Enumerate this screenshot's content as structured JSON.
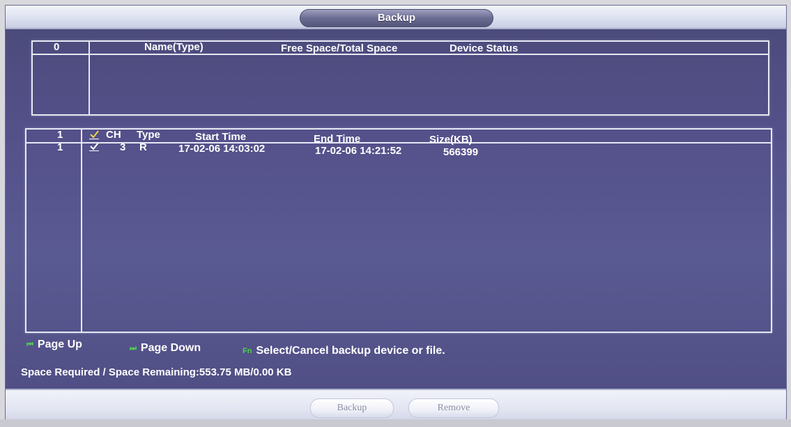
{
  "window": {
    "title": "Backup"
  },
  "device_table": {
    "count": "0",
    "columns": [
      "Name(Type)",
      "Free Space/Total Space",
      "Device Status"
    ]
  },
  "file_table": {
    "count": "1",
    "header_checked": true,
    "columns": [
      "CH",
      "Type",
      "Start Time",
      "End Time",
      "Size(KB)"
    ],
    "rows": [
      {
        "index": "1",
        "checked": true,
        "ch": "3",
        "type": "R",
        "start_time": "17-02-06 14:03:02",
        "end_time": "17-02-06 14:21:52",
        "size": "566399"
      }
    ]
  },
  "legend": {
    "page_up_icon": "page-up-key-icon",
    "page_up": "Page Up",
    "page_down_icon": "page-down-key-icon",
    "page_down": "Page Down",
    "fn_icon": "fn-key-icon",
    "fn_key": "Fn",
    "fn_text": "Select/Cancel backup device or file."
  },
  "status": {
    "space_text": "Space Required / Space Remaining:553.75 MB/0.00 KB"
  },
  "buttons": {
    "backup": "Backup",
    "remove": "Remove"
  },
  "colors": {
    "panel_bg": "#54508a",
    "accent_green": "#4cd64c",
    "check_yellow": "#e8d84a"
  }
}
